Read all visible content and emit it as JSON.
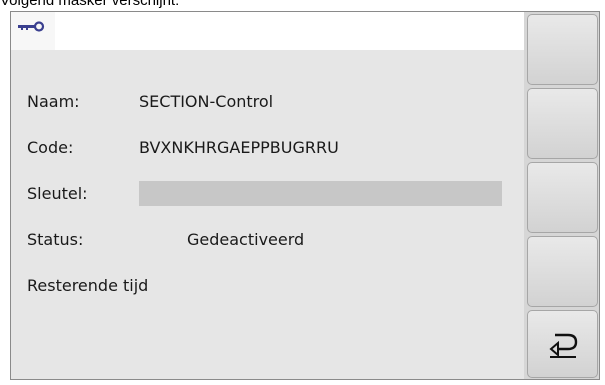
{
  "caption": "Volgend masker verschijnt:",
  "header": {
    "tab_icon": "key-icon"
  },
  "fields": {
    "name_label": "Naam:",
    "name_value": "SECTION-Control",
    "code_label": "Code:",
    "code_value": "BVXNKHRGAEPPBUGRRU",
    "key_label": "Sleutel:",
    "key_value": "",
    "status_label": "Status:",
    "status_value": "Gedeactiveerd",
    "remaining_label": "Resterende tijd"
  },
  "sidebar": {
    "buttons": [
      {
        "icon": ""
      },
      {
        "icon": ""
      },
      {
        "icon": ""
      },
      {
        "icon": ""
      },
      {
        "icon": "return-icon"
      }
    ]
  },
  "colors": {
    "accent": "#3a3f8f",
    "screen_bg": "#e6e6e6",
    "input_bg": "#c7c7c7"
  }
}
